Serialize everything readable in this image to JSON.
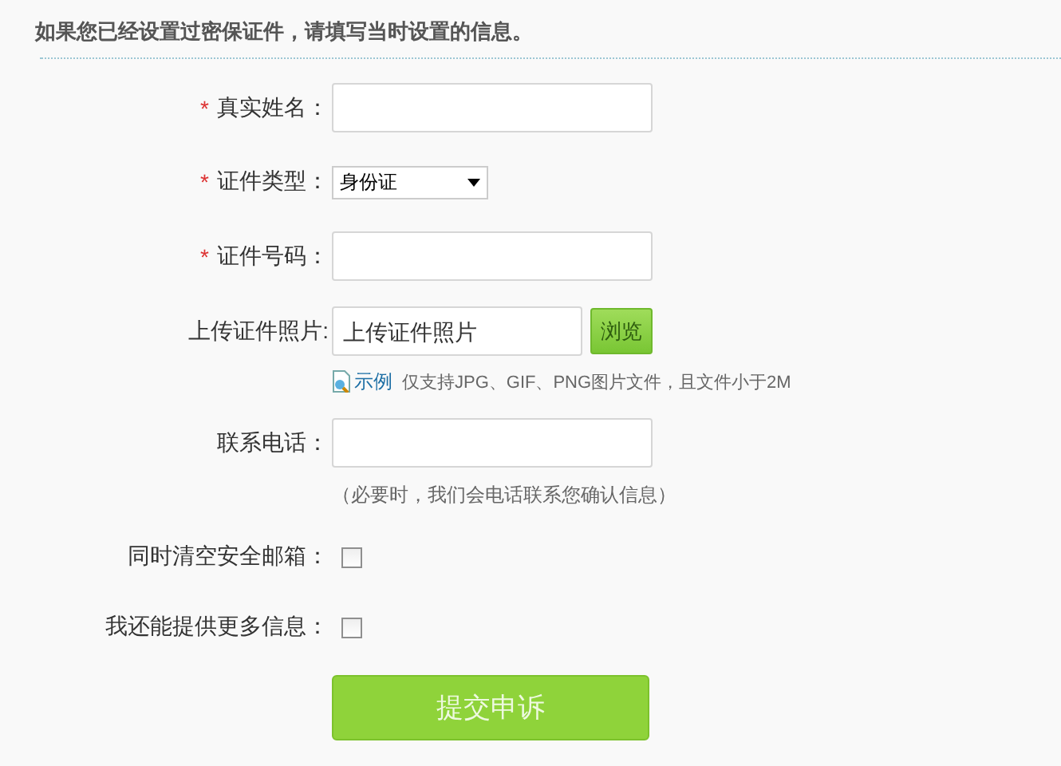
{
  "heading": "如果您已经设置过密保证件，请填写当时设置的信息。",
  "fields": [
    {
      "kind": "text",
      "marker": "*",
      "label": "真实姓名："
    },
    {
      "kind": "select",
      "marker": "*",
      "label": "证件类型：",
      "value": "身份证"
    },
    {
      "kind": "text",
      "marker": "*",
      "label": "证件号码："
    },
    {
      "kind": "file",
      "label": "上传证件照片:",
      "placeholder": "上传证件照片",
      "button": "浏览",
      "example_link": "示例",
      "hint": "仅支持JPG、GIF、PNG图片文件，且文件小于2M"
    },
    {
      "kind": "text",
      "label": "联系电话：",
      "note": "（必要时，我们会电话联系您确认信息）"
    },
    {
      "kind": "checkbox",
      "label": "同时清空安全邮箱：",
      "checked": false
    },
    {
      "kind": "checkbox",
      "label": "我还能提供更多信息：",
      "checked": false
    }
  ],
  "submit": "提交申诉"
}
